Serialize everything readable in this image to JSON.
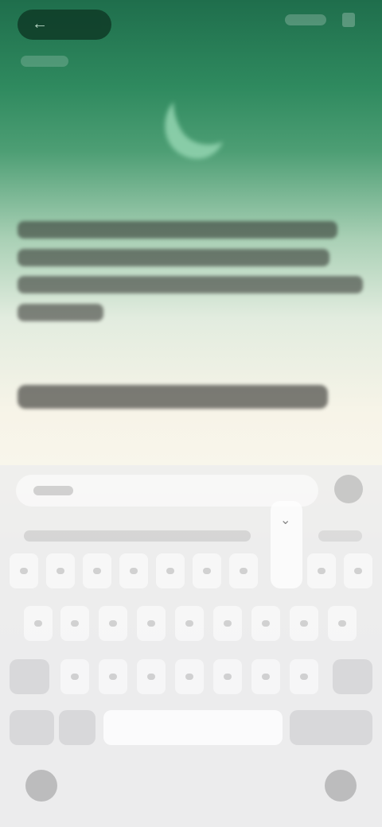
{
  "status_bar": {
    "back_icon": "arrow-left-icon"
  },
  "hero": {
    "icon": "moon-icon",
    "icon_color": "#8fd1ad"
  },
  "colors": {
    "header_green": "#1f6e4c",
    "background_cream": "#f8f6ec",
    "keyboard_gray": "#e9e9ea"
  },
  "keyboard": {
    "collapse_icon": "chevron-down-icon",
    "globe_icon": "globe-icon",
    "mic_icon": "mic-icon"
  }
}
